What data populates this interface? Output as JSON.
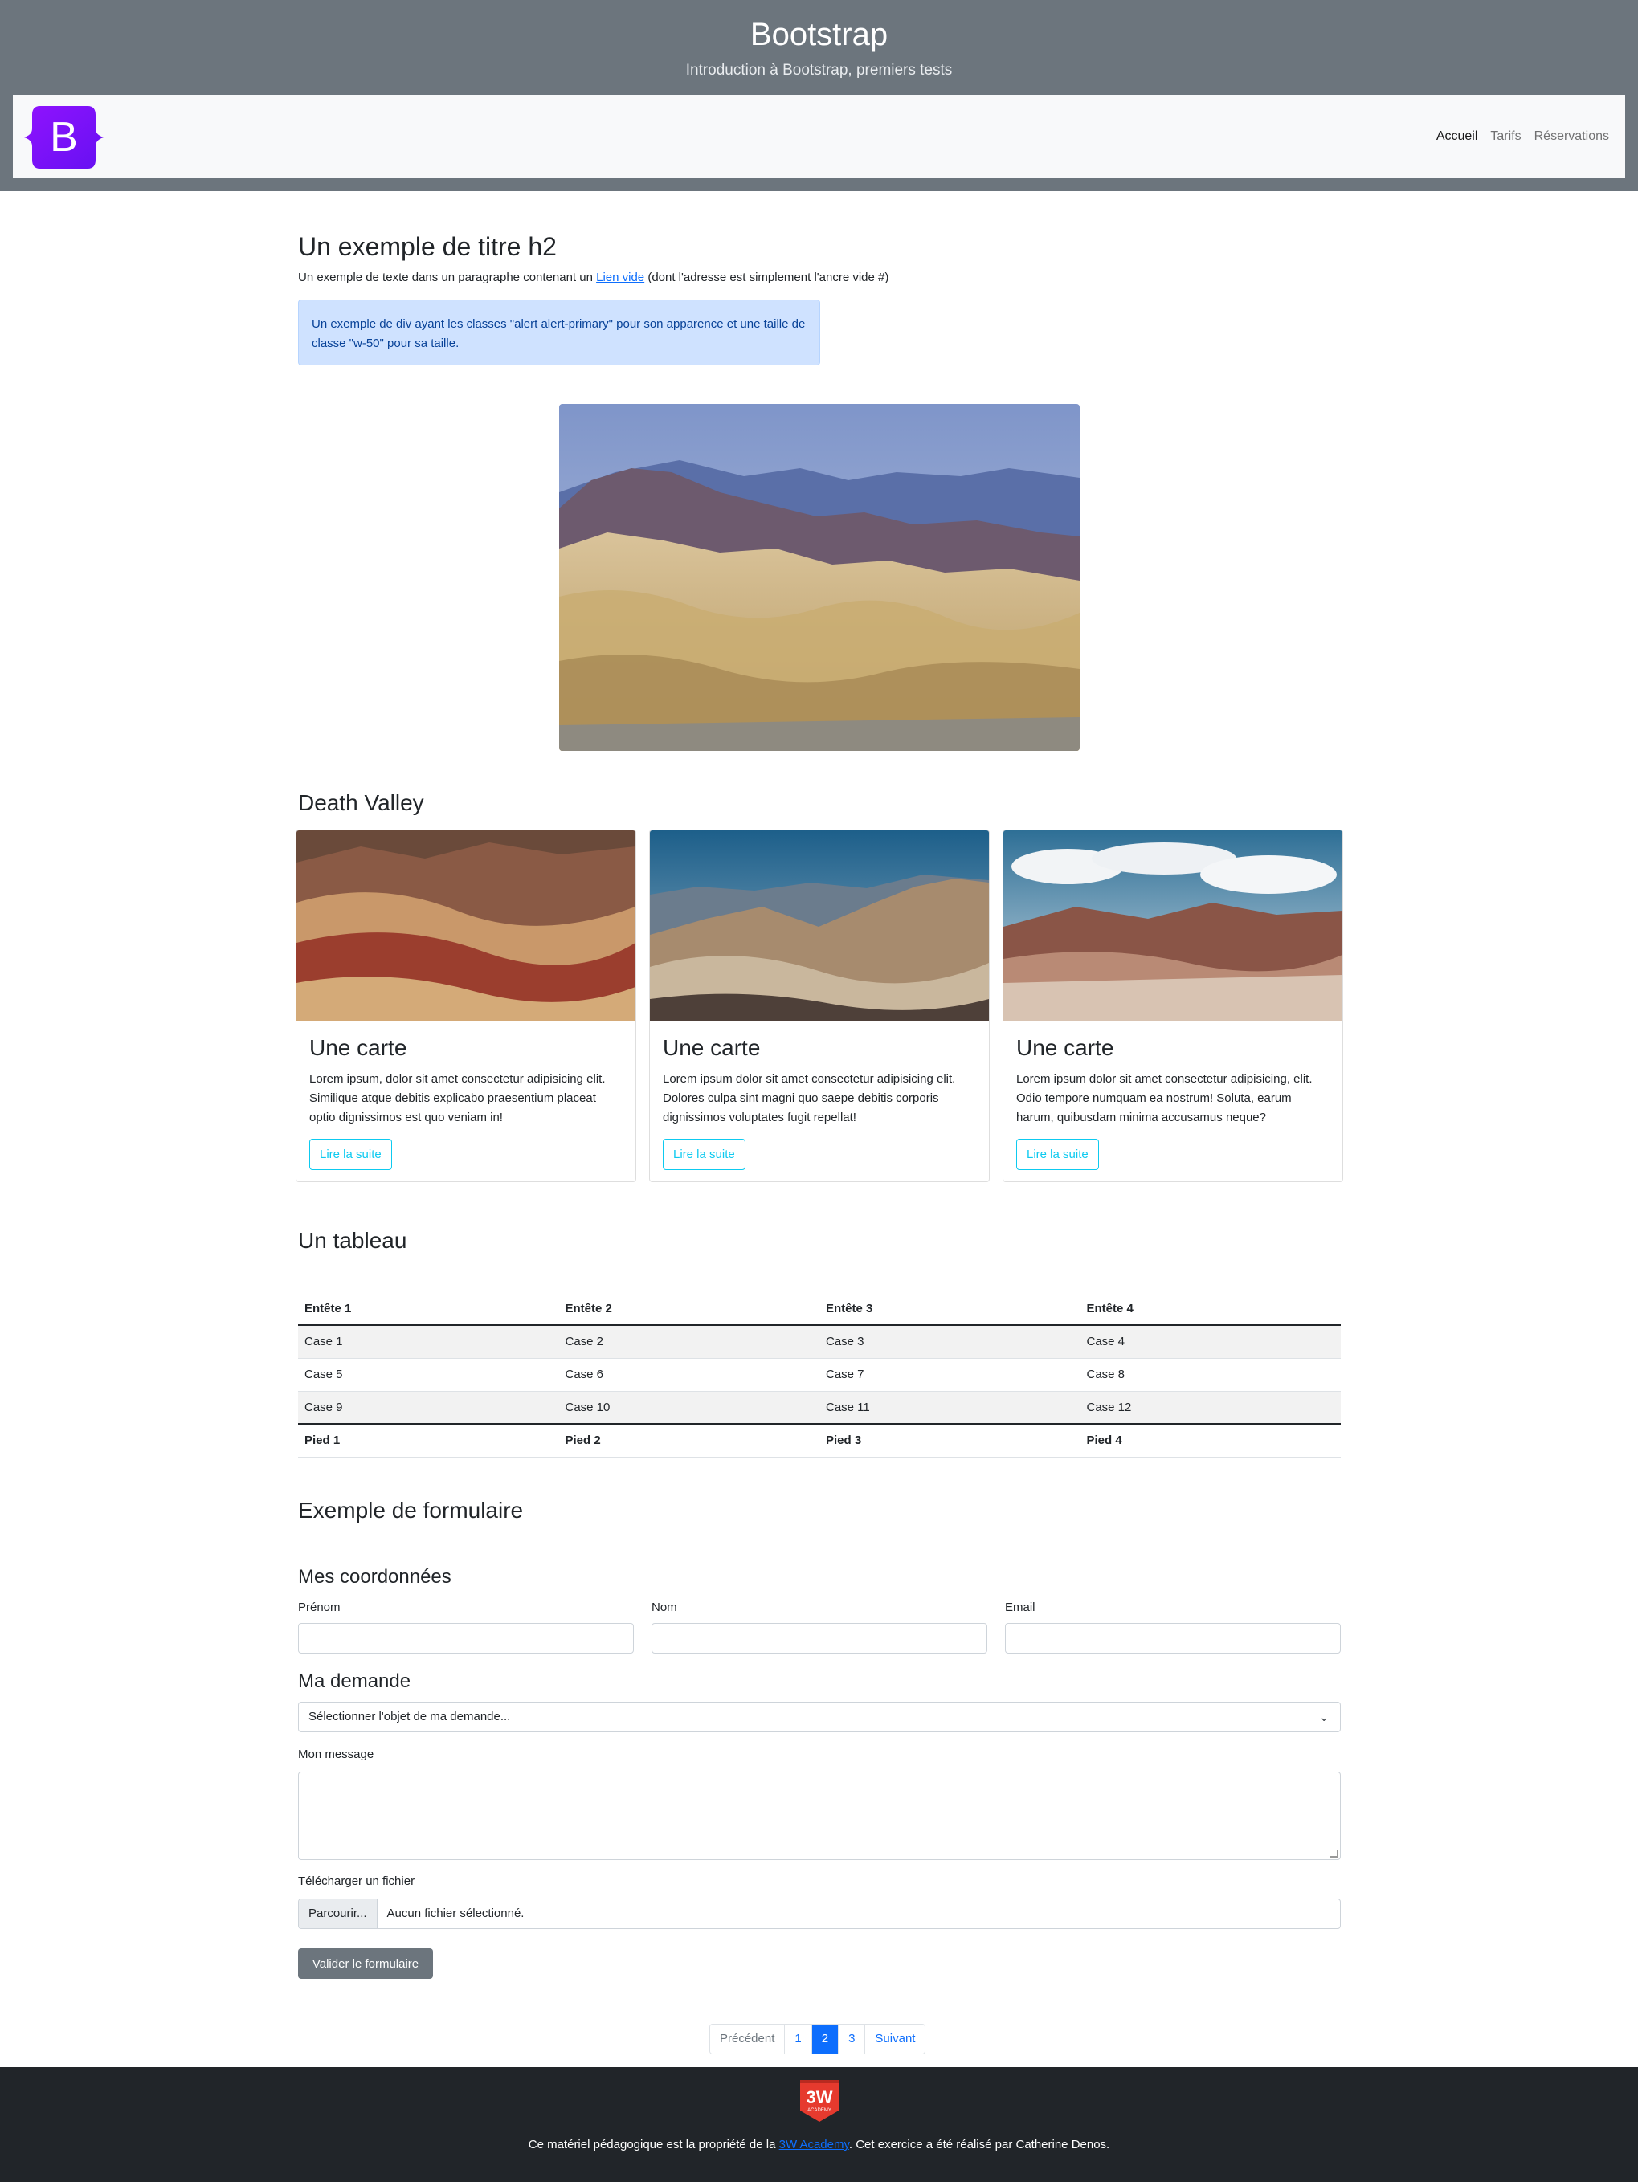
{
  "header": {
    "title": "Bootstrap",
    "subtitle": "Introduction à Bootstrap, premiers tests",
    "brand_letter": "B",
    "nav": [
      "Accueil",
      "Tarifs",
      "Réservations"
    ]
  },
  "intro": {
    "title": "Un exemple de titre h2",
    "text_before": "Un exemple de texte dans un paragraphe contenant un ",
    "link": "Lien vide",
    "text_after": " (dont l'adresse est simplement l'ancre vide #)",
    "alert": "Un exemple de div ayant les classes \"alert alert-primary\" pour son apparence et une taille de classe \"w-50\" pour sa taille."
  },
  "gallery": {
    "title": "Death Valley",
    "cards": [
      {
        "title": "Une carte",
        "text": "Lorem ipsum, dolor sit amet consectetur adipisicing elit. Similique atque debitis explicabo praesentium placeat optio dignissimos est quo veniam in!",
        "button": "Lire la suite"
      },
      {
        "title": "Une carte",
        "text": "Lorem ipsum dolor sit amet consectetur adipisicing elit. Dolores culpa sint magni quo saepe debitis corporis dignissimos voluptates fugit repellat!",
        "button": "Lire la suite"
      },
      {
        "title": "Une carte",
        "text": "Lorem ipsum dolor sit amet consectetur adipisicing, elit. Odio tempore numquam ea nostrum! Soluta, earum harum, quibusdam minima accusamus neque?",
        "button": "Lire la suite"
      }
    ]
  },
  "table": {
    "title": "Un tableau",
    "headers": [
      "Entête 1",
      "Entête 2",
      "Entête 3",
      "Entête 4"
    ],
    "rows": [
      [
        "Case 1",
        "Case 2",
        "Case 3",
        "Case 4"
      ],
      [
        "Case 5",
        "Case 6",
        "Case 7",
        "Case 8"
      ],
      [
        "Case 9",
        "Case 10",
        "Case 11",
        "Case 12"
      ]
    ],
    "footer": [
      "Pied 1",
      "Pied 2",
      "Pied 3",
      "Pied 4"
    ]
  },
  "form": {
    "title": "Exemple de formulaire",
    "contact_title": "Mes coordonnées",
    "labels": {
      "firstname": "Prénom",
      "lastname": "Nom",
      "email": "Email"
    },
    "request_title": "Ma demande",
    "select_value": "Sélectionner l'objet de ma demande...",
    "message_label": "Mon message",
    "file_label": "Télécharger un fichier",
    "file_button": "Parcourir...",
    "file_status": "Aucun fichier sélectionné.",
    "submit": "Valider le formulaire"
  },
  "pagination": {
    "prev": "Précédent",
    "pages": [
      "1",
      "2",
      "3"
    ],
    "active_page": "2",
    "next": "Suivant"
  },
  "footer": {
    "logo_text": "3W",
    "logo_subtext": "ACADEMY",
    "text_before": "Ce matériel pédagogique est la propriété de la ",
    "link": "3W Academy",
    "text_after": ". Cet exercice a été réalisé par Catherine Denos."
  },
  "colors": {
    "header_bg": "#6c757d",
    "primary": "#0d6efd",
    "info": "#0dcaf0",
    "footer_bg": "#212529",
    "brand_purple": "#7b1fe8"
  }
}
